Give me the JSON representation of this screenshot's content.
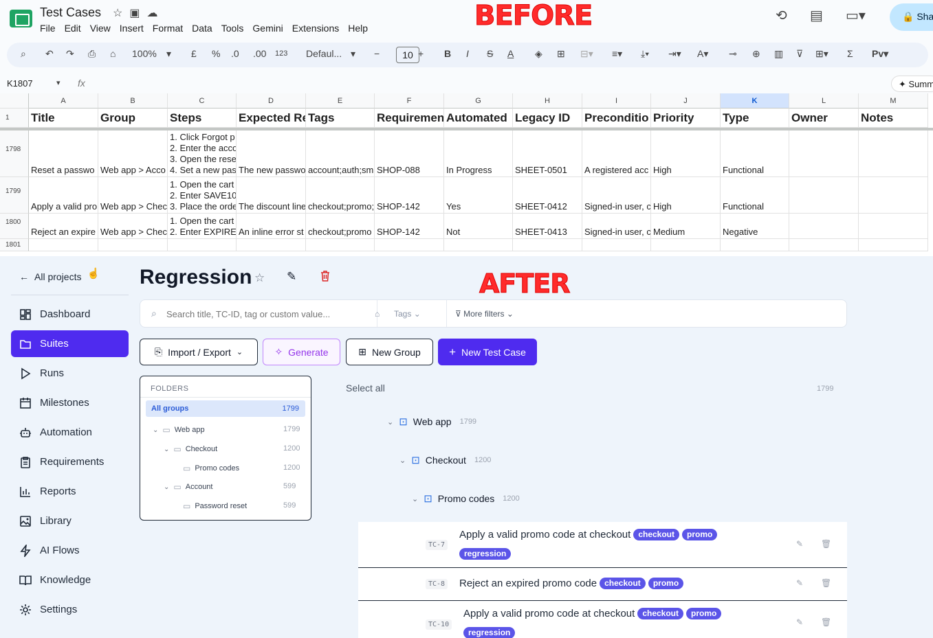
{
  "labels": {
    "before": "BEFORE",
    "after": "AFTER"
  },
  "sheets": {
    "title": "Test Cases",
    "menu": [
      "File",
      "Edit",
      "View",
      "Insert",
      "Format",
      "Data",
      "Tools",
      "Gemini",
      "Extensions",
      "Help"
    ],
    "share_label": "Sha",
    "toolbar": {
      "zoom": "100%",
      "currency": "£",
      "percent": "%",
      "dec_less": ".0",
      "dec_more": ".00",
      "num": "123",
      "font": "Defaul...",
      "font_size": "10"
    },
    "name_box": "K1807",
    "fx": "fx",
    "summarize": "Summ",
    "columns": [
      "A",
      "B",
      "C",
      "D",
      "E",
      "F",
      "G",
      "H",
      "I",
      "J",
      "K",
      "L",
      "M"
    ],
    "selected_column": "K",
    "headers": [
      "Title",
      "Group",
      "Steps",
      "Expected Re",
      "Tags",
      "Requiremen",
      "Automated",
      "Legacy ID",
      "Preconditio",
      "Priority",
      "Type",
      "Owner",
      "Notes"
    ],
    "header_row_number": "1",
    "rows": [
      {
        "num": "1798",
        "title": "Reset a passwo",
        "group": "Web app > Acco",
        "steps": [
          "1. Click Forgot p",
          "2. Enter the acco",
          "3. Open the rese",
          "4. Set a new pas"
        ],
        "expected": "The new passwo",
        "tags": "account;auth;sm",
        "requirement": "SHOP-088",
        "automated": "In Progress",
        "legacy_id": "SHEET-0501",
        "precondition": "A registered acc",
        "priority": "High",
        "type": "Functional"
      },
      {
        "num": "1799",
        "title": "Apply a valid pro",
        "group": "Web app > Chec",
        "steps": [
          "1. Open the cart",
          "2. Enter SAVE10",
          "3. Place the orde"
        ],
        "expected": "The discount line",
        "tags": "checkout;promo;",
        "requirement": "SHOP-142",
        "automated": "Yes",
        "legacy_id": "SHEET-0412",
        "precondition": "Signed-in user, c",
        "priority": "High",
        "type": "Functional"
      },
      {
        "num": "1800",
        "title": "Reject an expire",
        "group": "Web app > Chec",
        "steps": [
          "1. Open the cart",
          "2. Enter EXPIRE"
        ],
        "expected": "An inline error st",
        "tags": "checkout;promo",
        "requirement": "SHOP-142",
        "automated": "Not",
        "legacy_id": "SHEET-0413",
        "precondition": "Signed-in user, c",
        "priority": "Medium",
        "type": "Negative"
      },
      {
        "num": "1801"
      }
    ]
  },
  "app": {
    "back_label": "All projects",
    "nav": [
      {
        "label": "Dashboard",
        "icon": "dashboard-icon"
      },
      {
        "label": "Suites",
        "icon": "folder-icon",
        "active": true
      },
      {
        "label": "Runs",
        "icon": "play-icon"
      },
      {
        "label": "Milestones",
        "icon": "calendar-icon"
      },
      {
        "label": "Automation",
        "icon": "robot-icon"
      },
      {
        "label": "Requirements",
        "icon": "clipboard-icon"
      },
      {
        "label": "Reports",
        "icon": "bar-chart-icon"
      },
      {
        "label": "Library",
        "icon": "image-icon"
      },
      {
        "label": "AI Flows",
        "icon": "lightning-icon"
      },
      {
        "label": "Knowledge",
        "icon": "book-icon"
      },
      {
        "label": "Settings",
        "icon": "gear-icon"
      }
    ],
    "page_title": "Regression",
    "search_placeholder": "Search title, TC-ID, tag or custom value...",
    "tags_filter": "Tags",
    "more_filters": "More filters",
    "buttons": {
      "import_export": "Import / Export",
      "generate": "Generate",
      "new_group": "New Group",
      "new_test_case": "New Test Case"
    },
    "folders": {
      "header": "FOLDERS",
      "all_groups": {
        "label": "All groups",
        "count": "1799"
      },
      "items": [
        {
          "label": "Web app",
          "count": "1799"
        },
        {
          "label": "Checkout",
          "count": "1200"
        },
        {
          "label": "Promo codes",
          "count": "1200"
        },
        {
          "label": "Account",
          "count": "599"
        },
        {
          "label": "Password reset",
          "count": "599"
        }
      ]
    },
    "select_all": "Select all",
    "select_all_count": "1799",
    "tree": [
      {
        "label": "Web app",
        "count": "1799"
      },
      {
        "label": "Checkout",
        "count": "1200"
      },
      {
        "label": "Promo codes",
        "count": "1200"
      }
    ],
    "cases": [
      {
        "id": "TC-7",
        "title": "Apply a valid promo code at checkout",
        "tags": [
          "checkout",
          "promo",
          "regression"
        ]
      },
      {
        "id": "TC-8",
        "title": "Reject an expired promo code",
        "tags": [
          "checkout",
          "promo"
        ]
      },
      {
        "id": "TC-10",
        "title": "Apply a valid promo code at checkout",
        "tags": [
          "checkout",
          "promo",
          "regression"
        ]
      }
    ]
  }
}
